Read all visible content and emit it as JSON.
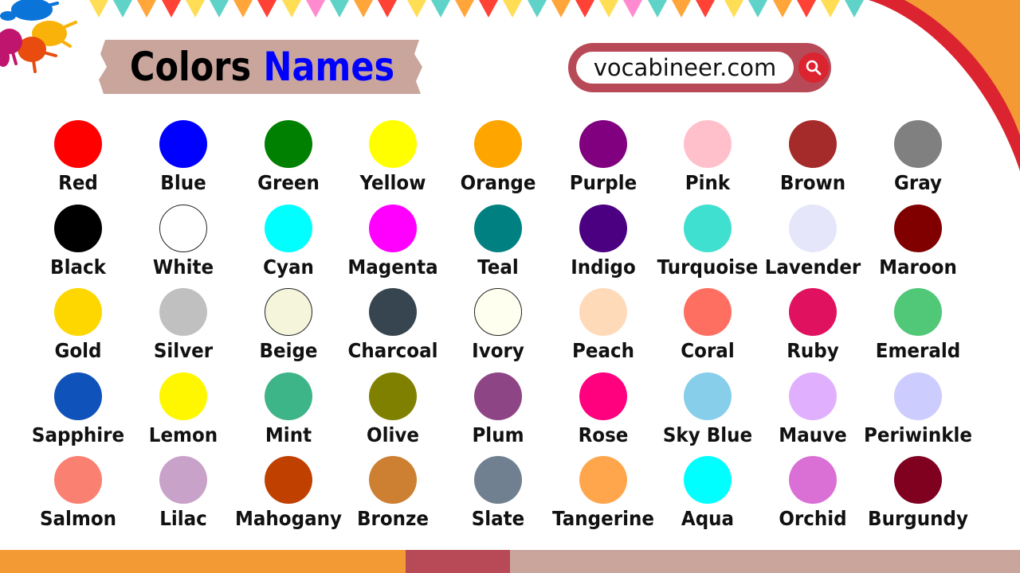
{
  "header": {
    "title_word_1": "Colors",
    "title_word_2": "Names",
    "title_word_1_color": "#000000",
    "title_word_2_color": "#0000ff",
    "banner_color": "#c9a59c"
  },
  "search": {
    "value": "vocabineer.com",
    "icon": "search-icon",
    "frame_color": "#b84a58",
    "button_color": "#dc2330"
  },
  "decor": {
    "pennant_colors": [
      "#ffdd55",
      "#5fd3c8",
      "#ffa53a",
      "#ff4136",
      "#ffdd55",
      "#5fd3c8",
      "#ffa53a",
      "#ff4136",
      "#ffdd55",
      "#ff8ad0",
      "#5fd3c8",
      "#ffa53a",
      "#ff4136",
      "#ffdd55",
      "#5fd3c8",
      "#ffa53a",
      "#ff4136",
      "#ffdd55",
      "#5fd3c8",
      "#ffa53a",
      "#ff4136",
      "#ffdd55",
      "#ff8ad0",
      "#5fd3c8",
      "#ffa53a",
      "#ff4136",
      "#ffdd55",
      "#5fd3c8",
      "#ffa53a",
      "#ff4136",
      "#ffdd55",
      "#5fd3c8"
    ],
    "corner_colors": [
      "#dc2330",
      "#f39a35"
    ],
    "splash_colors": [
      "#0a74d9",
      "#f8b20a",
      "#e84c0e",
      "#c0156e"
    ],
    "bottom_bar_colors": [
      "#f39a35",
      "#b84a58",
      "#c9a59c"
    ]
  },
  "colors": [
    [
      {
        "name": "Red",
        "hex": "#ff0000"
      },
      {
        "name": "Blue",
        "hex": "#0000ff"
      },
      {
        "name": "Green",
        "hex": "#008000"
      },
      {
        "name": "Yellow",
        "hex": "#ffff00"
      },
      {
        "name": "Orange",
        "hex": "#ffa500"
      },
      {
        "name": "Purple",
        "hex": "#800080"
      },
      {
        "name": "Pink",
        "hex": "#ffc0cb"
      },
      {
        "name": "Brown",
        "hex": "#a52a2a"
      },
      {
        "name": "Gray",
        "hex": "#808080"
      }
    ],
    [
      {
        "name": "Black",
        "hex": "#000000"
      },
      {
        "name": "White",
        "hex": "#ffffff",
        "outlined": true
      },
      {
        "name": "Cyan",
        "hex": "#00ffff"
      },
      {
        "name": "Magenta",
        "hex": "#ff00ff"
      },
      {
        "name": "Teal",
        "hex": "#008080"
      },
      {
        "name": "Indigo",
        "hex": "#4b0082"
      },
      {
        "name": "Turquoise",
        "hex": "#40e0d0"
      },
      {
        "name": "Lavender",
        "hex": "#e6e6fa"
      },
      {
        "name": "Maroon",
        "hex": "#800000"
      }
    ],
    [
      {
        "name": "Gold",
        "hex": "#ffd700"
      },
      {
        "name": "Silver",
        "hex": "#c0c0c0"
      },
      {
        "name": "Beige",
        "hex": "#f5f5dc",
        "outlined": true
      },
      {
        "name": "Charcoal",
        "hex": "#36454f"
      },
      {
        "name": "Ivory",
        "hex": "#fffff0",
        "outlined": true
      },
      {
        "name": "Peach",
        "hex": "#ffdab9"
      },
      {
        "name": "Coral",
        "hex": "#ff6f61"
      },
      {
        "name": "Ruby",
        "hex": "#e0115f"
      },
      {
        "name": "Emerald",
        "hex": "#50c878"
      }
    ],
    [
      {
        "name": "Sapphire",
        "hex": "#0f52ba"
      },
      {
        "name": "Lemon",
        "hex": "#fff700"
      },
      {
        "name": "Mint",
        "hex": "#3eb489"
      },
      {
        "name": "Olive",
        "hex": "#808000"
      },
      {
        "name": "Plum",
        "hex": "#8e4585"
      },
      {
        "name": "Rose",
        "hex": "#ff007f"
      },
      {
        "name": "Sky Blue",
        "hex": "#87ceeb"
      },
      {
        "name": "Mauve",
        "hex": "#e0b0ff"
      },
      {
        "name": "Periwinkle",
        "hex": "#ccccff"
      }
    ],
    [
      {
        "name": "Salmon",
        "hex": "#fa8072"
      },
      {
        "name": "Lilac",
        "hex": "#c8a2c8"
      },
      {
        "name": "Mahogany",
        "hex": "#c04000"
      },
      {
        "name": "Bronze",
        "hex": "#cd7f32"
      },
      {
        "name": "Slate",
        "hex": "#708090"
      },
      {
        "name": "Tangerine",
        "hex": "#ffa64d"
      },
      {
        "name": "Aqua",
        "hex": "#00ffff"
      },
      {
        "name": "Orchid",
        "hex": "#da70d6"
      },
      {
        "name": "Burgundy",
        "hex": "#800020"
      }
    ]
  ]
}
